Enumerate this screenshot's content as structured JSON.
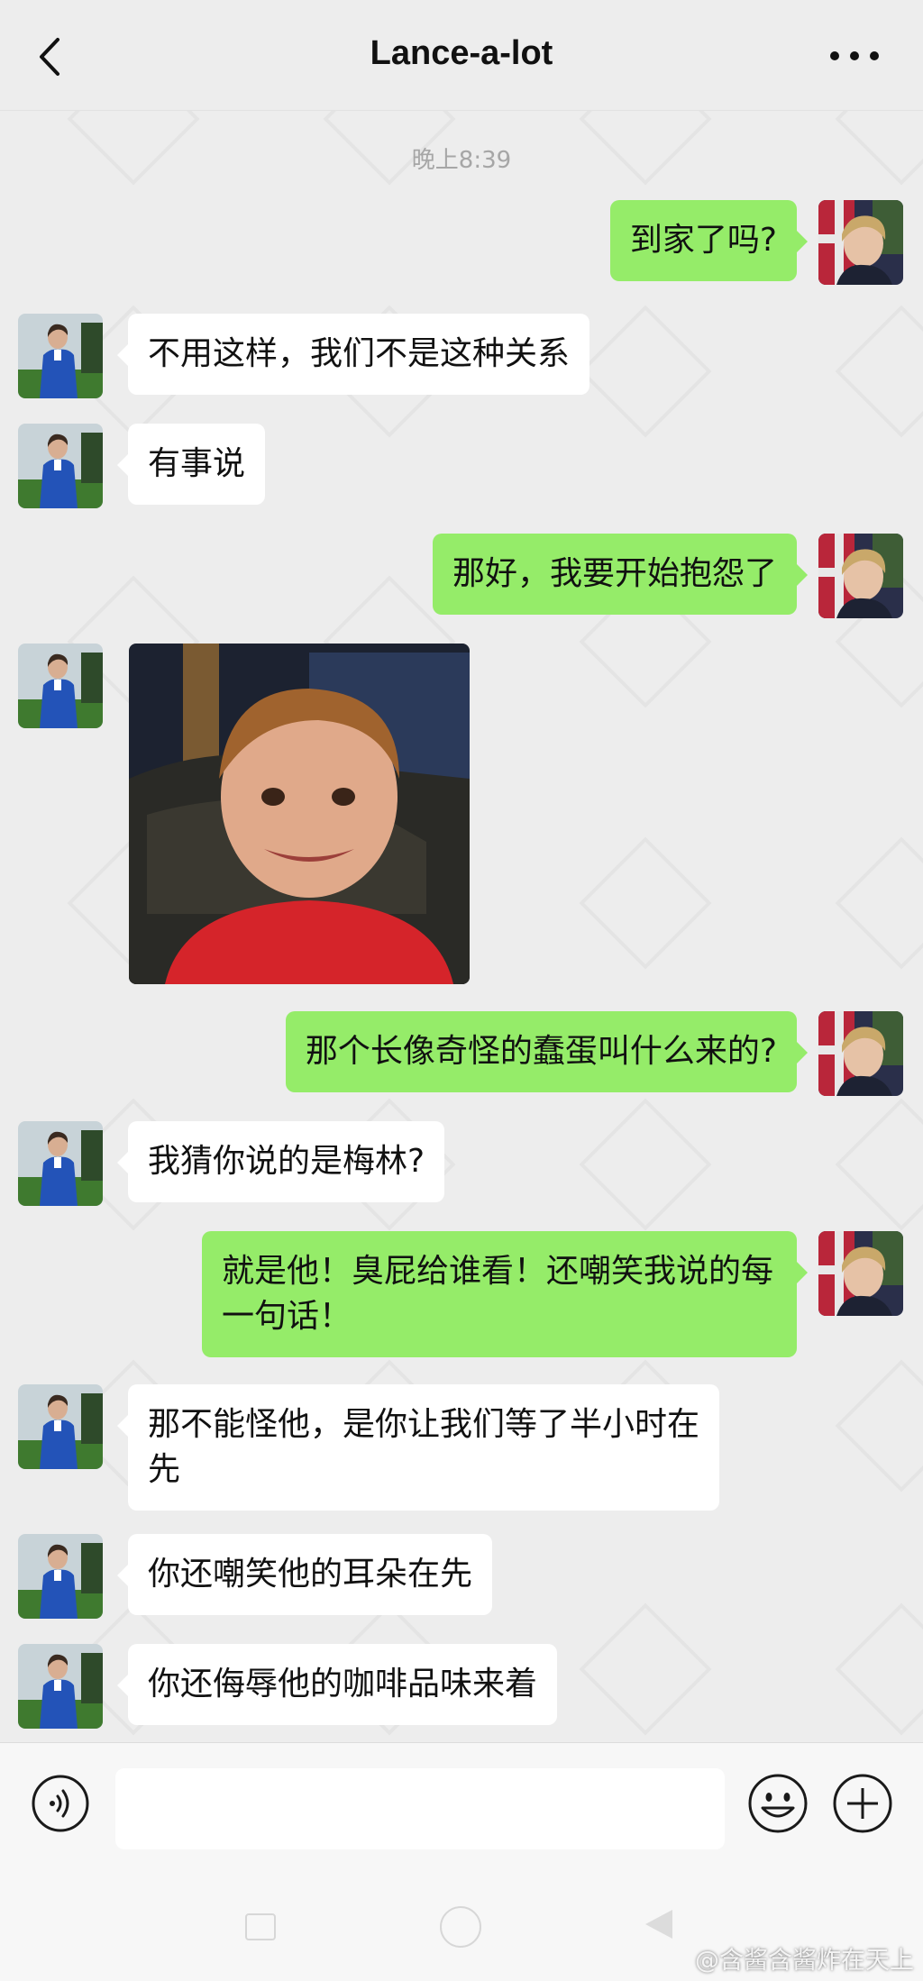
{
  "header": {
    "title": "Lance-a-lot"
  },
  "timestamp": "晚上8:39",
  "messages": [
    {
      "side": "out",
      "text": "到家了吗?"
    },
    {
      "side": "in",
      "text": "不用这样，我们不是这种关系"
    },
    {
      "side": "in",
      "text": "有事说"
    },
    {
      "side": "out",
      "text": "那好，我要开始抱怨了"
    },
    {
      "side": "in",
      "type": "image",
      "image": "smiling-boy-red-shirt-photo"
    },
    {
      "side": "out",
      "text": "那个长像奇怪的蠢蛋叫什么来的?"
    },
    {
      "side": "in",
      "text": "我猜你说的是梅林?"
    },
    {
      "side": "out",
      "text": "就是他！臭屁给谁看！还嘲笑我说的每一句话！"
    },
    {
      "side": "in",
      "text": "那不能怪他，是你让我们等了半小时在先"
    },
    {
      "side": "in",
      "text": "你还嘲笑他的耳朵在先"
    },
    {
      "side": "in",
      "text": "你还侮辱他的咖啡品味来着"
    }
  ],
  "input": {
    "value": ""
  },
  "watermark": "@含酱含酱炸在天上",
  "colors": {
    "background": "#ededed",
    "outgoing_bubble": "#95ec69",
    "incoming_bubble": "#ffffff"
  },
  "icons": [
    "back-arrow-icon",
    "more-icon",
    "voice-icon",
    "emoji-icon",
    "plus-icon"
  ]
}
